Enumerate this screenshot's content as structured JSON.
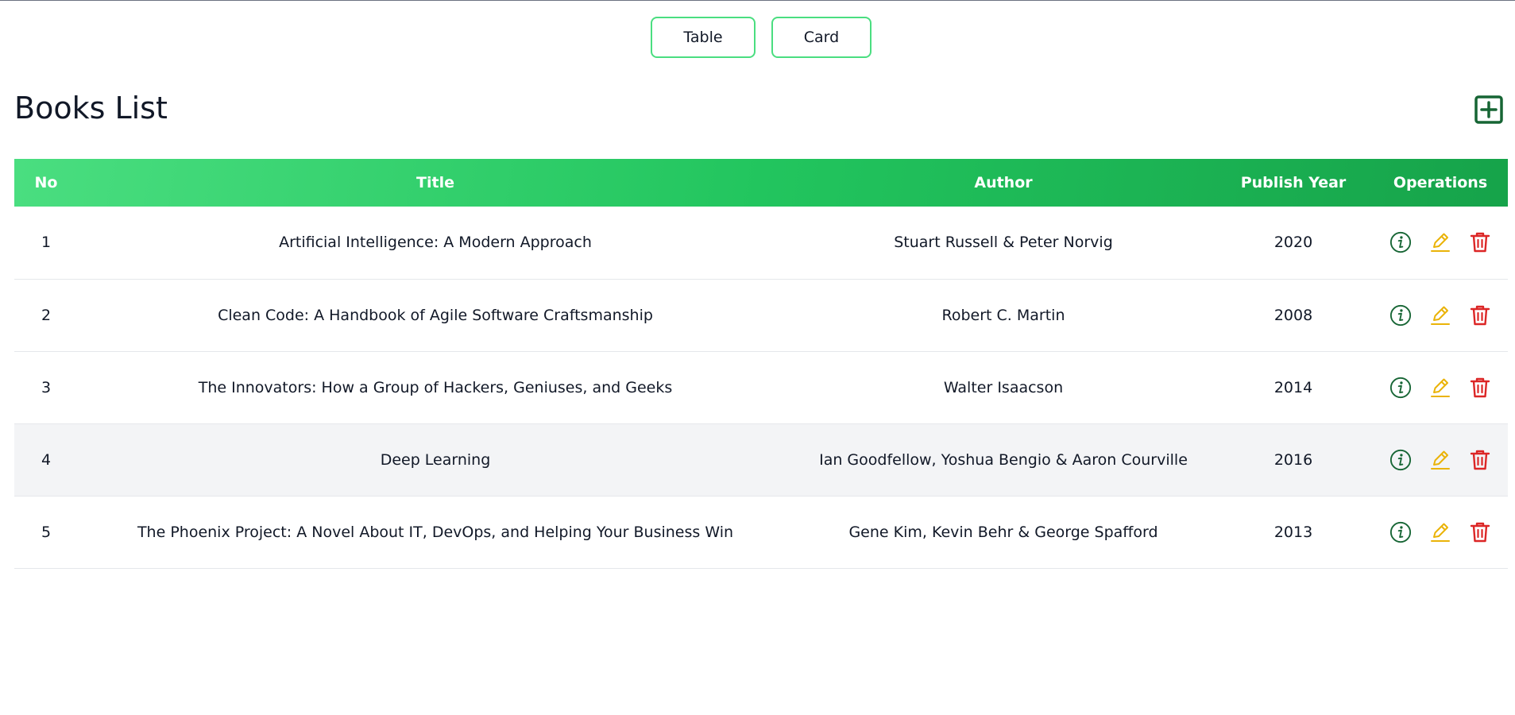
{
  "view_toggle": {
    "table_label": "Table",
    "card_label": "Card"
  },
  "page_title": "Books List",
  "icons": {
    "add": "plus-square-icon",
    "info": "info-circle-icon",
    "edit": "pencil-icon",
    "delete": "trash-icon"
  },
  "colors": {
    "header_gradient_start": "#4ade80",
    "header_gradient_end": "#16a34a",
    "toggle_border": "#4ade80",
    "add_icon": "#166534",
    "info_icon": "#166534",
    "edit_icon": "#eab308",
    "delete_icon": "#dc2626",
    "highlight_row": "#f3f4f6"
  },
  "table": {
    "headers": {
      "no": "No",
      "title": "Title",
      "author": "Author",
      "year": "Publish Year",
      "operations": "Operations"
    },
    "rows": [
      {
        "no": "1",
        "title": "Artificial Intelligence: A Modern Approach",
        "author": "Stuart Russell & Peter Norvig",
        "year": "2020"
      },
      {
        "no": "2",
        "title": "Clean Code: A Handbook of Agile Software Craftsmanship",
        "author": "Robert C. Martin",
        "year": "2008"
      },
      {
        "no": "3",
        "title": "The Innovators: How a Group of Hackers, Geniuses, and Geeks",
        "author": "Walter Isaacson",
        "year": "2014"
      },
      {
        "no": "4",
        "title": "Deep Learning",
        "author": "Ian Goodfellow, Yoshua Bengio & Aaron Courville",
        "year": "2016"
      },
      {
        "no": "5",
        "title": "The Phoenix Project: A Novel About IT, DevOps, and Helping Your Business Win",
        "author": "Gene Kim, Kevin Behr & George Spafford",
        "year": "2013"
      }
    ]
  }
}
